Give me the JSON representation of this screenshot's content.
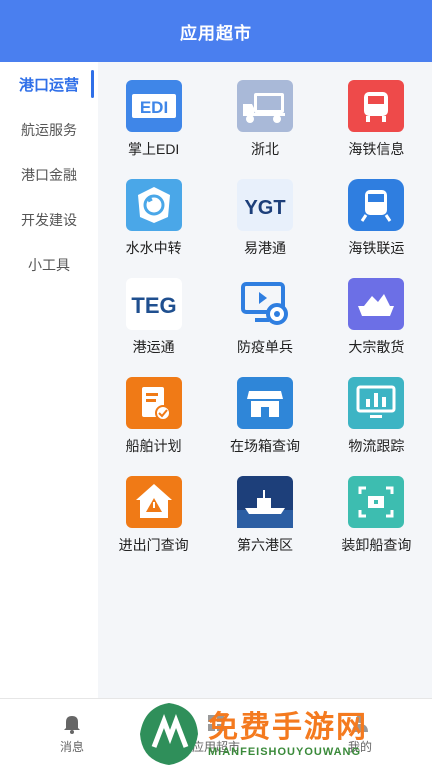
{
  "header": {
    "title": "应用超市"
  },
  "sidebar": {
    "items": [
      {
        "label": "港口运营",
        "active": true
      },
      {
        "label": "航运服务"
      },
      {
        "label": "港口金融"
      },
      {
        "label": "开发建设"
      },
      {
        "label": "小工具"
      }
    ]
  },
  "apps": [
    {
      "label": "掌上EDI",
      "icon": "edi-icon",
      "color": "#3f86e8",
      "text": "EDI"
    },
    {
      "label": "浙北",
      "icon": "truck-icon",
      "color": "#a9b9d8"
    },
    {
      "label": "海铁信息",
      "icon": "train-icon",
      "color": "#ee4a4a"
    },
    {
      "label": "水水中转",
      "icon": "transfer-icon",
      "color": "#4aa7e8"
    },
    {
      "label": "易港通",
      "icon": "ygt-logo-icon",
      "color": "#e8f0fb",
      "text": "YGT"
    },
    {
      "label": "海铁联运",
      "icon": "train-icon",
      "color": "#2f7ee0"
    },
    {
      "label": "港运通",
      "icon": "teg-logo-icon",
      "color": "#ffffff",
      "text": "TEG"
    },
    {
      "label": "防疫单兵",
      "icon": "camera-monitor-icon",
      "color": "#2f7ee0"
    },
    {
      "label": "大宗散货",
      "icon": "ship-cargo-icon",
      "color": "#6c6fe6"
    },
    {
      "label": "船舶计划",
      "icon": "document-check-icon",
      "color": "#f07a16"
    },
    {
      "label": "在场箱查询",
      "icon": "store-icon",
      "color": "#2f86d8"
    },
    {
      "label": "物流跟踪",
      "icon": "chart-monitor-icon",
      "color": "#3db4c4"
    },
    {
      "label": "进出门查询",
      "icon": "warning-house-icon",
      "color": "#f07a16"
    },
    {
      "label": "第六港区",
      "icon": "ship-photo-icon",
      "color": "#1d3f7a"
    },
    {
      "label": "装卸船查询",
      "icon": "scan-icon",
      "color": "#3dbdb0"
    }
  ],
  "tabbar": {
    "items": [
      {
        "label": "消息",
        "icon": "bell-icon"
      },
      {
        "label": "应用超市",
        "icon": "grid-icon"
      },
      {
        "label": "我的",
        "icon": "user-icon"
      }
    ]
  },
  "watermark": {
    "cn": "免费手游网",
    "en": "MIANFEISHOUYOUWANG"
  }
}
